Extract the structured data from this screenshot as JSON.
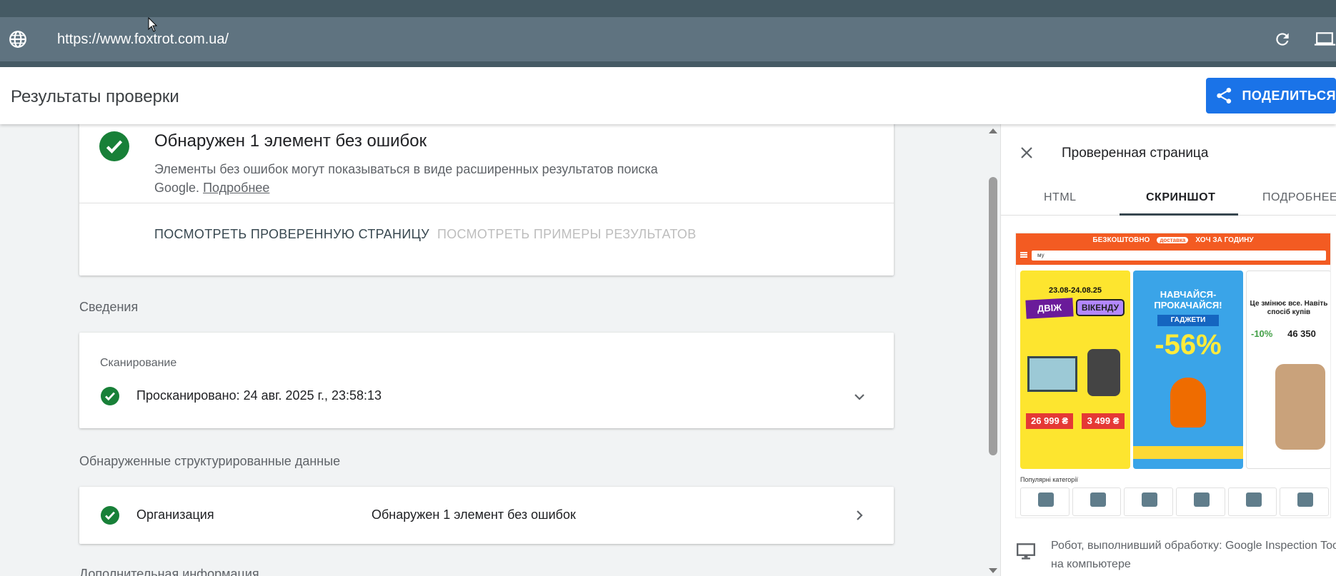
{
  "urlbar": {
    "url": "https://www.foxtrot.com.ua/"
  },
  "header": {
    "title": "Результаты проверки",
    "share_label": "ПОДЕЛИТЬСЯ"
  },
  "summary_card": {
    "heading": "Обнаружен 1 элемент без ошибок",
    "description": "Элементы без ошибок могут показываться в виде расширенных результатов поиска Google.",
    "learn_more": "Подробнее",
    "action_view_page": "ПОСМОТРЕТЬ ПРОВЕРЕННУЮ СТРАНИЦУ",
    "action_view_examples": "ПОСМОТРЕТЬ ПРИМЕРЫ РЕЗУЛЬТАТОВ"
  },
  "details": {
    "section_label": "Сведения",
    "crawl_label": "Сканирование",
    "crawl_status": "Просканировано: 24 авг. 2025 г., 23:58:13"
  },
  "structured_data": {
    "section_label": "Обнаруженные структурированные данные",
    "item_name": "Организация",
    "item_status": "Обнаружен 1 элемент без ошибок"
  },
  "additional_info": {
    "section_label": "Дополнительная информация"
  },
  "panel": {
    "title": "Проверенная страница",
    "tabs": [
      {
        "label": "HTML",
        "active": false
      },
      {
        "label": "СКРИНШОТ",
        "active": true
      },
      {
        "label": "ПОДРОБНЕЕ",
        "active": false
      }
    ],
    "footer_line1": "Робот, выполнивший обработку: Google Inspection Tool",
    "footer_line2": "на компьютере"
  },
  "screenshot_preview": {
    "promo_left": "БЕЗКОШТОВНО",
    "promo_pill": "доставка",
    "promo_right": "ХОЧ ЗА ГОДИНУ",
    "search_text": "му",
    "banner1": {
      "date": "23.08-24.08.25",
      "tag1": "ДВІЖ",
      "tag2": "ВІКЕНДУ",
      "price1": "26 999 ₴",
      "price2": "3 499 ₴"
    },
    "banner2": {
      "headline": "НАВЧАЙСЯ-ПРОКАЧАЙСЯ!",
      "tag": "ГАДЖЕТИ",
      "discount": "-56%"
    },
    "banner3": {
      "headline": "Це змінює все. Навіть спосіб купів",
      "discount": "-10%",
      "price": "46 350"
    },
    "categories_label": "Популярні категорії"
  },
  "colors": {
    "accent": "#1a73e8",
    "success": "#188038",
    "urlbar": "#5f7380"
  }
}
